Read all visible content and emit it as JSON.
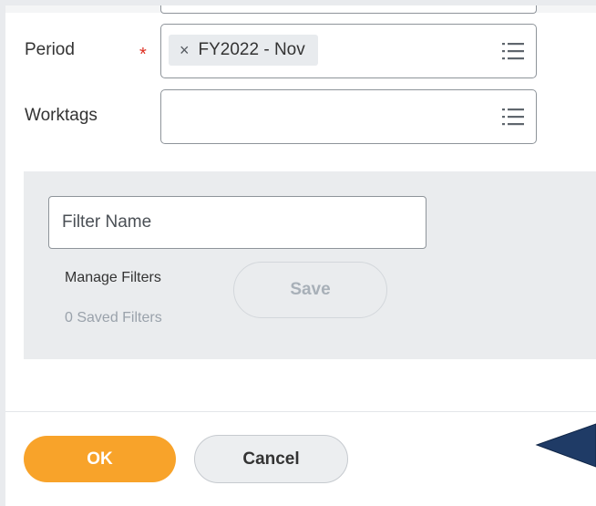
{
  "form": {
    "period": {
      "label": "Period",
      "required_marker": "*",
      "selected": "FY2022 - Nov",
      "remove_icon": "×"
    },
    "worktags": {
      "label": "Worktags",
      "value": ""
    }
  },
  "filter_panel": {
    "filter_name_placeholder": "Filter Name",
    "manage_filters_label": "Manage Filters",
    "saved_filters_label": "0 Saved Filters",
    "save_label": "Save"
  },
  "footer": {
    "ok_label": "OK",
    "cancel_label": "Cancel"
  },
  "colors": {
    "primary_button": "#f8a32a",
    "required": "#de2e21",
    "annotation_arrow": "#1f3b66"
  },
  "icons": {
    "prompt": "list-icon",
    "remove": "close-icon",
    "annotation": "pointer-arrow-icon"
  }
}
